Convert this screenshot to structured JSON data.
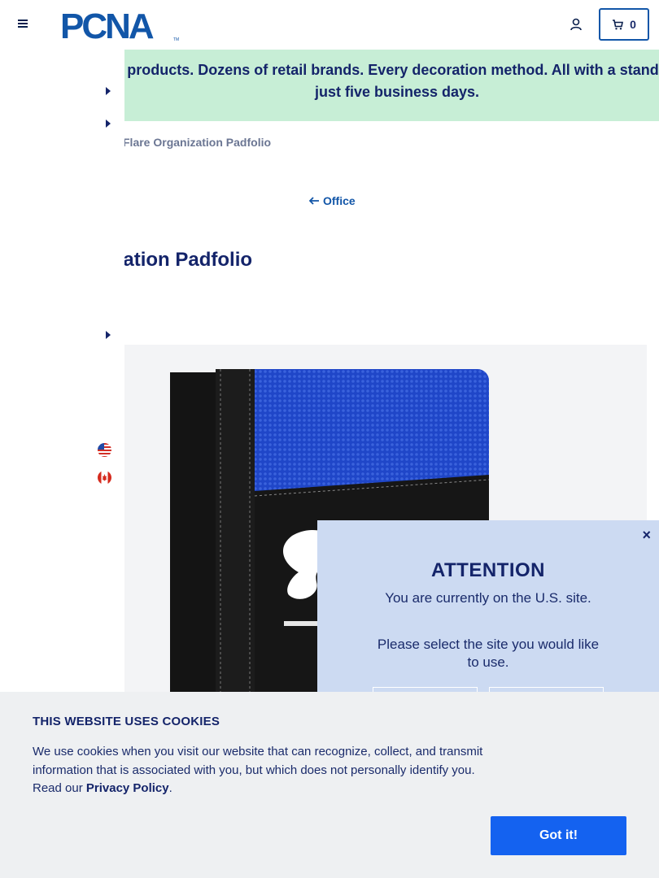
{
  "header": {
    "logo_text": "PCNA",
    "logo_tm": "TM",
    "cart_count": "0"
  },
  "banner": {
    "text": "Thousands of products. Dozens of retail brands. Every decoration method. All with a standard lead time of just five business days."
  },
  "breadcrumb": {
    "current": "Flare Organization Padfolio"
  },
  "back_link": {
    "label": "Office"
  },
  "product": {
    "title": "Flare Organization Padfolio"
  },
  "modal": {
    "title": "ATTENTION",
    "line1": "You are currently on the U.S. site.",
    "line2": "Please select the site you would like to use.",
    "close": "×"
  },
  "cookie": {
    "title": "THIS WEBSITE USES COOKIES",
    "body_prefix": "We use cookies when you visit our website that can recognize, collect, and transmit information that is associated with you, but which does not personally identify you. Read our ",
    "link": "Privacy Policy",
    "body_suffix": ".",
    "button": "Got it!"
  },
  "colors": {
    "brand_navy": "#14246a",
    "brand_blue": "#1256a8",
    "banner_bg": "#c7eed6",
    "modal_bg": "#ccdaf2",
    "cookie_button": "#1462f0"
  }
}
